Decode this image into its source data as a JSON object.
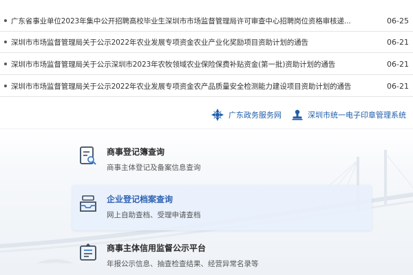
{
  "news": [
    {
      "title": "广东省事业单位2023年集中公开招聘高校毕业生深圳市市场监督管理局许可审查中心招聘岗位资格审核递...",
      "date": "06-25"
    },
    {
      "title": "深圳市市场监督管理局关于公示2022年农业发展专项资金农业产业化奖励项目资助计划的通告",
      "date": "06-21"
    },
    {
      "title": "深圳市市场监督管理局关于公示深圳市2023年农牧领域农业保险保费补贴资金(第一批)资助计划的通告",
      "date": "06-21"
    },
    {
      "title": "深圳市市场监督管理局关于公示2022年农业发展专项资金农产品质量安全检测能力建设项目资助计划的通告",
      "date": "06-21"
    }
  ],
  "links": {
    "gd_gov": {
      "label": "广东政务服务网",
      "icon": "gd-gov-service-icon"
    },
    "seal": {
      "label": "深圳市统一电子印章管理系统",
      "icon": "seal-system-icon"
    }
  },
  "services": [
    {
      "name": "商事登记簿查询",
      "desc": "商事主体登记及备案信息查询",
      "icon": "register-search-icon"
    },
    {
      "name": "企业登记档案查询",
      "desc": "网上自助查档、受理申请查档",
      "icon": "archive-tray-icon"
    },
    {
      "name": "商事主体信用监督公示平台",
      "desc": "年报公示信息、抽查检查结果、经营异常名录等",
      "icon": "credit-bulletin-icon"
    }
  ],
  "colors": {
    "link": "#1f5da8",
    "active_title": "#2f62b3",
    "active_bg": "#e8f0fc"
  }
}
